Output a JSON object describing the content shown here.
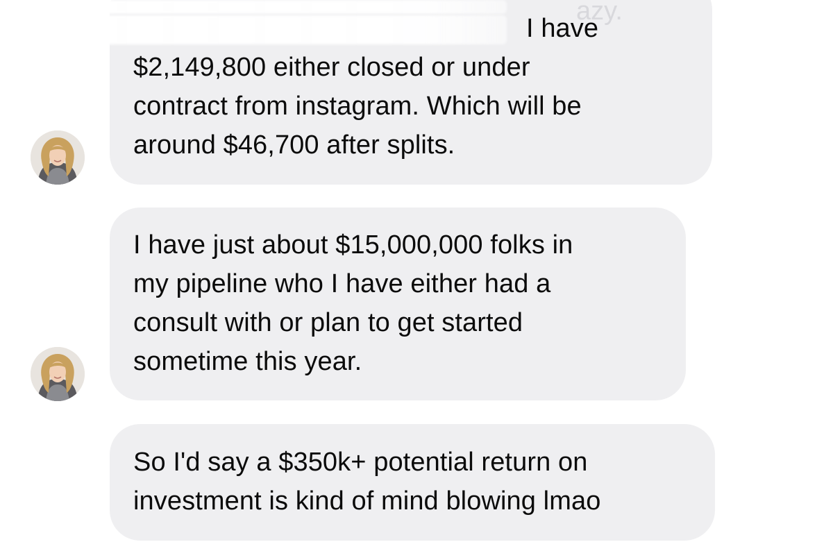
{
  "conversation": {
    "messages": [
      {
        "text": "I have $2,149,800 either closed or under contract from instagram. Which will be around $46,700 after splits.",
        "line_1": "I have",
        "line_2": "$2,149,800 either closed or under",
        "line_3": "contract from instagram. Which will be",
        "line_4": "around $46,700 after splits.",
        "obscured_fragment": "azy."
      },
      {
        "text": "I have just about $15,000,000 folks in my pipeline who I have either had a consult with or plan to get started sometime this year.",
        "line_1": "I have just about $15,000,000 folks in",
        "line_2": "my pipeline who I have either had a",
        "line_3": "consult with or plan to get started",
        "line_4": "sometime this year."
      },
      {
        "text": "So I'd say a $350k+ potential return on investment is kind of mind blowing lmao",
        "line_1": "So I'd say a $350k+ potential return on",
        "line_2": "investment is kind of mind blowing lmao"
      }
    ]
  },
  "colors": {
    "bubble": "#efeff1",
    "text": "#0b0b0b",
    "background": "#ffffff"
  },
  "icons": {
    "avatar_1": "user-avatar",
    "avatar_2": "user-avatar"
  }
}
